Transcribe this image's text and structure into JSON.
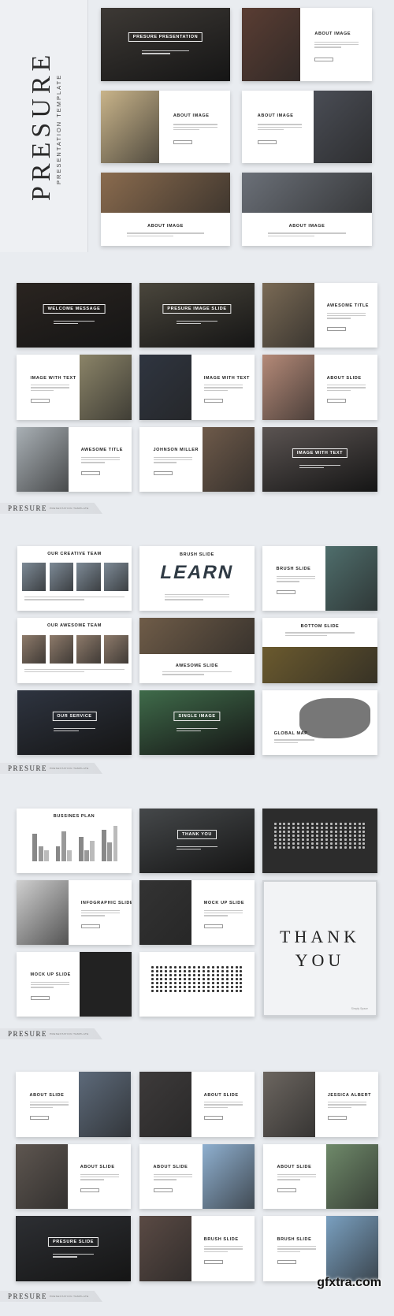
{
  "brand": {
    "title": "PRESURE",
    "subtitle": "PRESENTATION TEMPLATE",
    "watermark": "gfxtra.com"
  },
  "sections": [
    {
      "footer": null,
      "slides": [
        {
          "title": "PRESURE PRESENTATION",
          "variant": "cover",
          "tone": "#3d3935"
        },
        {
          "title": "ABOUT IMAGE",
          "variant": "img-left",
          "tone": "#5a3d33"
        },
        {
          "title": "ABOUT IMAGE",
          "variant": "img-left",
          "tone": "#c9b48a"
        },
        {
          "title": "ABOUT IMAGE",
          "variant": "img-right",
          "tone": "#4a4d55"
        },
        {
          "title": "ABOUT IMAGE",
          "variant": "img-top",
          "tone": "#8a6b4e"
        },
        {
          "title": "ABOUT IMAGE",
          "variant": "img-top",
          "tone": "#6b7078"
        }
      ]
    },
    {
      "footer": {
        "title": "PRESURE",
        "subtitle": "PRESENTATION TEMPLATE"
      },
      "slides": [
        {
          "title": "WELCOME MESSAGE",
          "variant": "cover",
          "tone": "#2a2420"
        },
        {
          "title": "PRESURE IMAGE SLIDE",
          "variant": "cover",
          "tone": "#4a463c"
        },
        {
          "title": "AWESOME TITLE",
          "variant": "img-left",
          "tone": "#7a6a55"
        },
        {
          "title": "IMAGE WITH TEXT",
          "variant": "img-right",
          "tone": "#8b8468"
        },
        {
          "title": "IMAGE WITH TEXT",
          "variant": "img-left",
          "tone": "#2f3540"
        },
        {
          "title": "ABOUT SLIDE",
          "variant": "img-left",
          "tone": "#b58a78"
        },
        {
          "title": "AWESOME TITLE",
          "variant": "img-left",
          "tone": "#a9b0b5"
        },
        {
          "title": "JOHNSON MILLER",
          "variant": "img-right",
          "tone": "#6e5a4a"
        },
        {
          "title": "IMAGE WITH TEXT",
          "variant": "cover",
          "tone": "#5b5452"
        }
      ]
    },
    {
      "footer": {
        "title": "PRESURE",
        "subtitle": "PRESENTATION TEMPLATE"
      },
      "slides": [
        {
          "title": "OUR CREATIVE TEAM",
          "variant": "team",
          "tone": "#7d8a96"
        },
        {
          "title": "BRUSH SLIDE",
          "variant": "brush-text",
          "tone": "#2f3a44",
          "extra": "LEARN"
        },
        {
          "title": "BRUSH SLIDE",
          "variant": "img-right",
          "tone": "#4f6e6c"
        },
        {
          "title": "OUR AWESOME TEAM",
          "variant": "team",
          "tone": "#8d7a6a"
        },
        {
          "title": "AWESOME SLIDE",
          "variant": "img-top",
          "tone": "#6f5c48"
        },
        {
          "title": "BOTTOM SLIDE",
          "variant": "img-bottom",
          "tone": "#6b5a2e"
        },
        {
          "title": "OUR SERVICE",
          "variant": "cover",
          "tone": "#2e3440"
        },
        {
          "title": "SINGLE IMAGE",
          "variant": "cover",
          "tone": "#3f6b4a"
        },
        {
          "title": "GLOBAL MAP",
          "variant": "map",
          "tone": "#777777"
        }
      ]
    },
    {
      "footer": {
        "title": "PRESURE",
        "subtitle": "PRESENTATION TEMPLATE"
      },
      "slides": [
        {
          "title": "BUSSINES PLAN",
          "variant": "chart",
          "tone": "#9a9a9a"
        },
        {
          "title": "THANK YOU",
          "variant": "cover",
          "tone": "#45484a"
        },
        {
          "title": "",
          "variant": "icons-dark",
          "tone": "#2c2c2c"
        },
        {
          "title": "INFOGRAPHIC SLIDE",
          "variant": "img-left",
          "tone": "#d0d0d0"
        },
        {
          "title": "MOCK UP SLIDE",
          "variant": "img-left",
          "tone": "#333333"
        },
        {
          "title": "THANK YOU",
          "variant": "thankyou",
          "tone": "#f2f3f5",
          "lines": [
            "THANK",
            "YOU"
          ],
          "small": "Simply Space"
        },
        {
          "title": "MOCK UP SLIDE",
          "variant": "img-right",
          "tone": "#222222"
        },
        {
          "title": "",
          "variant": "icons-light",
          "tone": "#ffffff"
        }
      ]
    },
    {
      "footer": {
        "title": "PRESURE",
        "subtitle": "PRESENTATION TEMPLATE"
      },
      "slides": [
        {
          "title": "ABOUT SLIDE",
          "variant": "img-right",
          "tone": "#5d6a7a"
        },
        {
          "title": "ABOUT SLIDE",
          "variant": "img-left",
          "tone": "#3d3a3a"
        },
        {
          "title": "JESSICA ALBERT",
          "variant": "img-left",
          "tone": "#6c6660"
        },
        {
          "title": "ABOUT SLIDE",
          "variant": "img-left",
          "tone": "#5e5650"
        },
        {
          "title": "ABOUT SLIDE",
          "variant": "img-right",
          "tone": "#8fb0d0"
        },
        {
          "title": "ABOUT SLIDE",
          "variant": "img-right",
          "tone": "#6f8a6a"
        },
        {
          "title": "PRESURE SLIDE",
          "variant": "cover",
          "tone": "#2d2f33"
        },
        {
          "title": "BRUSH SLIDE",
          "variant": "img-left",
          "tone": "#5a4a44"
        },
        {
          "title": "BRUSH SLIDE",
          "variant": "img-right",
          "tone": "#7aa0c0"
        }
      ]
    }
  ]
}
